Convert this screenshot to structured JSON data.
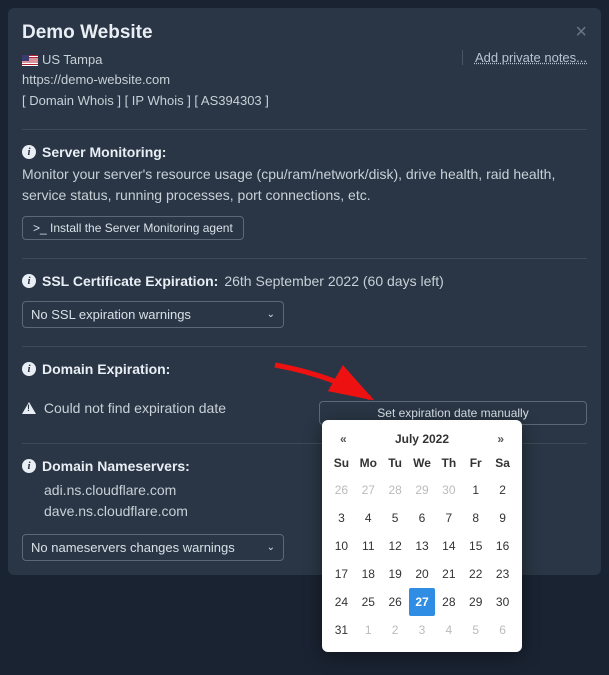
{
  "title": "Demo Website",
  "close_label": "×",
  "location": {
    "flag": "us",
    "text": "US Tampa"
  },
  "notes_link": "Add private notes...",
  "url": "https://demo-website.com",
  "meta": "[ Domain Whois ] [ IP Whois ] [ AS394303 ]",
  "server_monitoring": {
    "title": "Server Monitoring:",
    "desc": "Monitor your server's resource usage (cpu/ram/network/disk), drive health, raid health, service status, running processes, port connections, etc.",
    "install_btn": ">_ Install the Server Monitoring agent"
  },
  "ssl": {
    "title": "SSL Certificate Expiration:",
    "value": "26th September 2022 (60 days left)",
    "select": "No SSL expiration warnings"
  },
  "domain_exp": {
    "title": "Domain Expiration:",
    "warn": "Could not find expiration date",
    "set_btn": "Set expiration date manually"
  },
  "nameservers": {
    "title": "Domain Nameservers:",
    "list": [
      "adi.ns.cloudflare.com",
      "dave.ns.cloudflare.com"
    ],
    "select": "No nameservers changes warnings"
  },
  "datepicker": {
    "prev": "«",
    "next": "»",
    "title": "July 2022",
    "dow": [
      "Su",
      "Mo",
      "Tu",
      "We",
      "Th",
      "Fr",
      "Sa"
    ],
    "rows": [
      [
        {
          "d": "26",
          "m": true
        },
        {
          "d": "27",
          "m": true
        },
        {
          "d": "28",
          "m": true
        },
        {
          "d": "29",
          "m": true
        },
        {
          "d": "30",
          "m": true
        },
        {
          "d": "1"
        },
        {
          "d": "2"
        }
      ],
      [
        {
          "d": "3"
        },
        {
          "d": "4"
        },
        {
          "d": "5"
        },
        {
          "d": "6"
        },
        {
          "d": "7"
        },
        {
          "d": "8"
        },
        {
          "d": "9"
        }
      ],
      [
        {
          "d": "10"
        },
        {
          "d": "11"
        },
        {
          "d": "12"
        },
        {
          "d": "13"
        },
        {
          "d": "14"
        },
        {
          "d": "15"
        },
        {
          "d": "16"
        }
      ],
      [
        {
          "d": "17"
        },
        {
          "d": "18"
        },
        {
          "d": "19"
        },
        {
          "d": "20"
        },
        {
          "d": "21"
        },
        {
          "d": "22"
        },
        {
          "d": "23"
        }
      ],
      [
        {
          "d": "24"
        },
        {
          "d": "25"
        },
        {
          "d": "26"
        },
        {
          "d": "27",
          "sel": true
        },
        {
          "d": "28"
        },
        {
          "d": "29"
        },
        {
          "d": "30"
        }
      ],
      [
        {
          "d": "31"
        },
        {
          "d": "1",
          "m": true
        },
        {
          "d": "2",
          "m": true
        },
        {
          "d": "3",
          "m": true
        },
        {
          "d": "4",
          "m": true
        },
        {
          "d": "5",
          "m": true
        },
        {
          "d": "6",
          "m": true
        }
      ]
    ]
  }
}
